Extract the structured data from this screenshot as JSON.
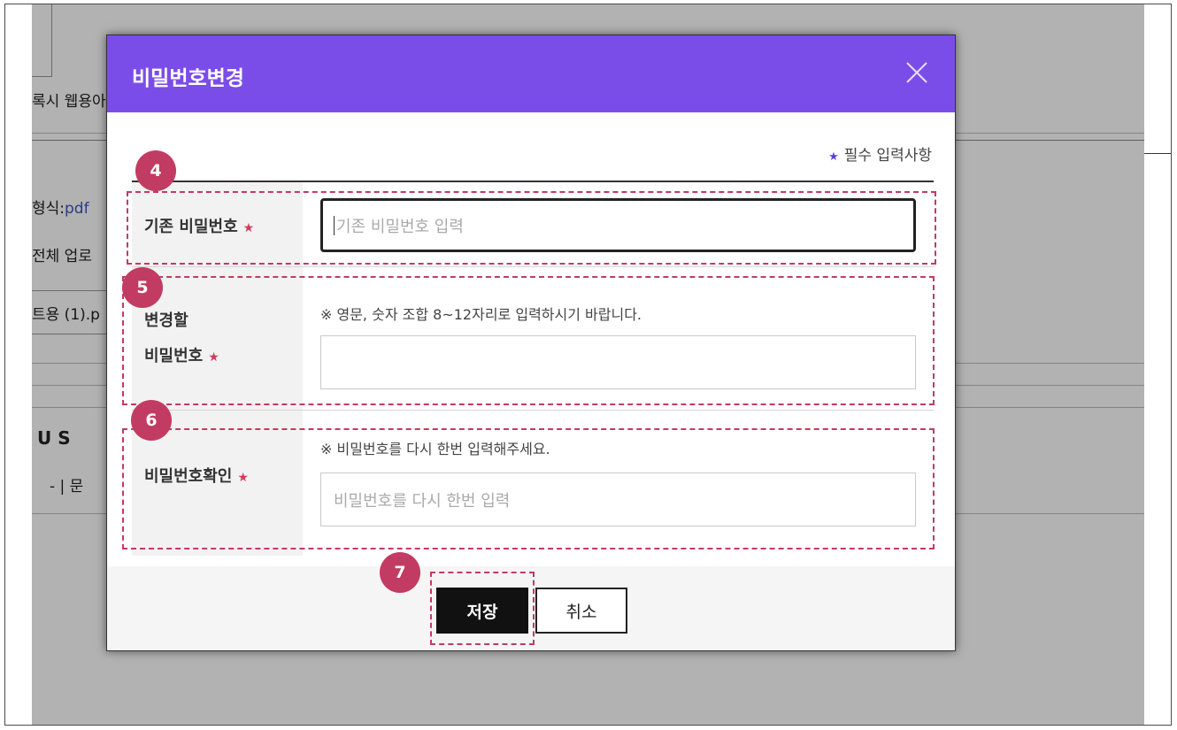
{
  "background_page": {
    "frag_1": "록시 웹용아",
    "frag_2": "형식:",
    "frag_2_value": "pdf",
    "frag_3": "전체 업로",
    "frag_4": "트용 (1).p",
    "frag_5": "U  S",
    "frag_6": "- | 문"
  },
  "modal": {
    "title": "비밀번호변경",
    "required_note": "필수 입력사항",
    "fields": {
      "current_password": {
        "label": "기존 비밀번호",
        "placeholder": "기존 비밀번호 입력"
      },
      "new_password": {
        "label_line1": "변경할",
        "label_line2": "비밀번호",
        "hint": "※ 영문, 숫자 조합 8~12자리로 입력하시기 바랍니다."
      },
      "confirm_password": {
        "label": "비밀번호확인",
        "hint": "※ 비밀번호를 다시 한번 입력해주세요.",
        "placeholder": "비밀번호를 다시 한번 입력"
      }
    },
    "buttons": {
      "save": "저장",
      "cancel": "취소"
    }
  },
  "annotations": {
    "badge_4": "4",
    "badge_5": "5",
    "badge_6": "6",
    "badge_7": "7"
  },
  "colors": {
    "header": "#7b4de8",
    "annotation": "#c23b62",
    "required_star": "#d43a5a"
  }
}
